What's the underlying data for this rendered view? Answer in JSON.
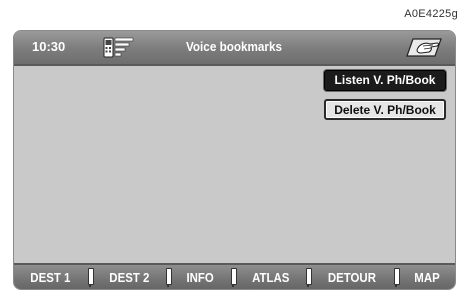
{
  "figure_code": "A0E4225g",
  "header": {
    "clock": "10:30",
    "title": "Voice bookmarks",
    "left_icon": "phone-signal-icon",
    "right_icon": "hand-on-keypad-icon"
  },
  "menu": {
    "listen_label": "Listen V. Ph/Book",
    "delete_label": "Delete V. Ph/Book"
  },
  "bottom_tabs": [
    "DEST 1",
    "DEST 2",
    "INFO",
    "ATLAS",
    "DETOUR",
    "MAP"
  ],
  "colors": {
    "header_bg": "#7c7c7c",
    "screen_bg": "#c9c9c9",
    "selected_bg": "#1b1b1b"
  }
}
